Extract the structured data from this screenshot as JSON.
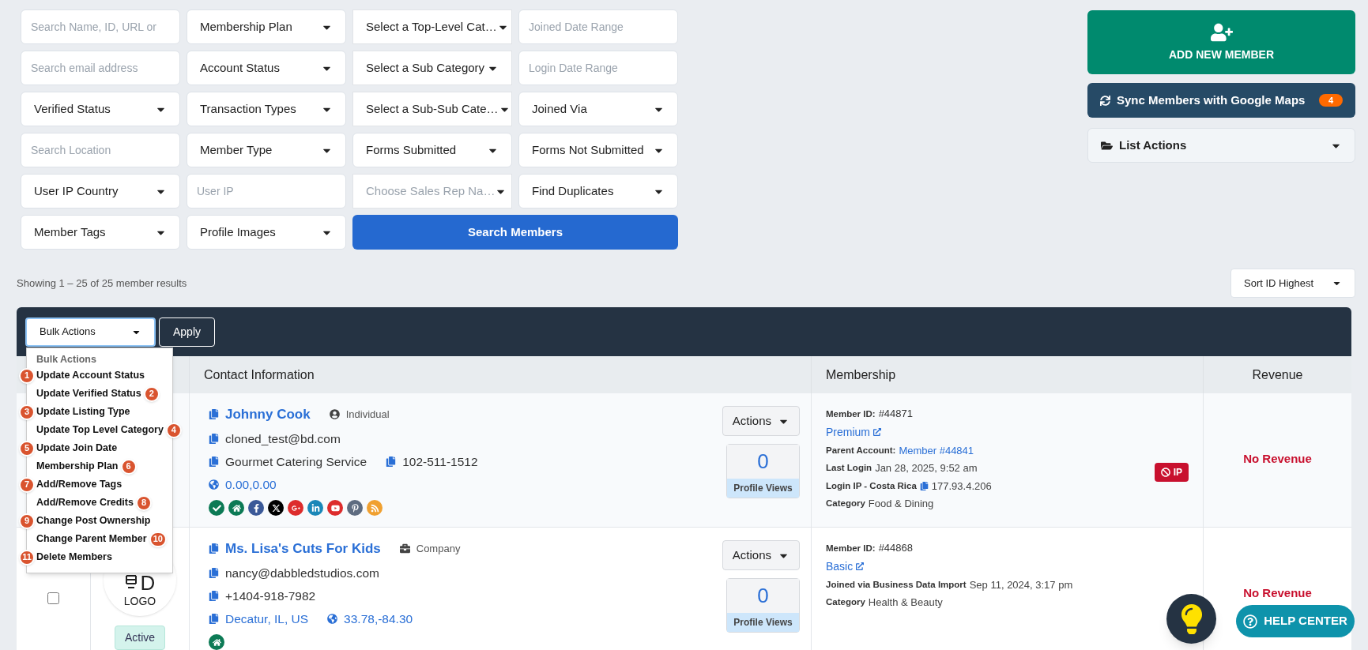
{
  "filters": [
    {
      "kind": "input",
      "placeholder": "Search Name, ID, URL or"
    },
    {
      "kind": "select",
      "value": "Membership Plan"
    },
    {
      "kind": "category-select",
      "value": "Select a Top-Level Cat…"
    },
    {
      "kind": "input",
      "placeholder": "Joined Date Range"
    },
    {
      "kind": "input",
      "placeholder": "Search email address"
    },
    {
      "kind": "select",
      "value": "Account Status"
    },
    {
      "kind": "category-select",
      "value": "Select a Sub Category"
    },
    {
      "kind": "input",
      "placeholder": "Login Date Range"
    },
    {
      "kind": "select",
      "value": "Verified Status"
    },
    {
      "kind": "select",
      "value": "Transaction Types"
    },
    {
      "kind": "category-select",
      "value": "Select a Sub-Sub Cate…"
    },
    {
      "kind": "select",
      "value": "Joined Via"
    },
    {
      "kind": "input",
      "placeholder": "Search Location"
    },
    {
      "kind": "select",
      "value": "Member Type"
    },
    {
      "kind": "select",
      "value": "Forms Submitted"
    },
    {
      "kind": "select",
      "value": "Forms Not Submitted"
    },
    {
      "kind": "select",
      "value": "User IP Country"
    },
    {
      "kind": "input",
      "placeholder": "User IP"
    },
    {
      "kind": "category-select",
      "value": "Choose Sales Rep Na…",
      "muted": true
    },
    {
      "kind": "select",
      "value": "Find Duplicates"
    },
    {
      "kind": "select",
      "value": "Member Tags"
    },
    {
      "kind": "select",
      "value": "Profile Images"
    },
    {
      "kind": "submit",
      "value": "Search Members"
    }
  ],
  "add_member": {
    "label": "ADD NEW MEMBER"
  },
  "sync": {
    "label": "Sync Members with Google Maps",
    "count": "4"
  },
  "list_actions": {
    "label": "List Actions"
  },
  "results_text": "Showing 1 – 25 of 25 member results",
  "sort": {
    "value": "Sort ID Highest"
  },
  "bulk": {
    "value": "Bulk Actions",
    "apply": "Apply",
    "menu_header": "Bulk Actions",
    "menu": [
      {
        "badge": "1",
        "label": "Update Account Status",
        "kind": "badge-left"
      },
      {
        "badge": "2",
        "label": "Update Verified Status",
        "kind": "badge-right"
      },
      {
        "badge": "3",
        "label": "Update Listing Type",
        "kind": "badge-left"
      },
      {
        "badge": "4",
        "label": "Update Top Level Category",
        "kind": "badge-right"
      },
      {
        "badge": "5",
        "label": "Update Join Date",
        "kind": "badge-left"
      },
      {
        "badge": "6",
        "label": "Membership Plan",
        "kind": "badge-right"
      },
      {
        "badge": "7",
        "label": "Add/Remove Tags",
        "kind": "badge-left"
      },
      {
        "badge": "8",
        "label": "Add/Remove Credits",
        "kind": "badge-right"
      },
      {
        "badge": "9",
        "label": "Change Post Ownership",
        "kind": "badge-left"
      },
      {
        "badge": "10",
        "label": "Change Parent Member",
        "kind": "badge-right"
      },
      {
        "badge": "11",
        "label": "Delete Members",
        "kind": "badge-left"
      }
    ]
  },
  "table": {
    "columns": [
      "Contact Information",
      "Membership",
      "Revenue"
    ],
    "rows": [
      {
        "name": "Johnny Cook",
        "type": {
          "kind": "person",
          "label": "Individual"
        },
        "lines": [
          [
            {
              "kind": "copy",
              "text": "cloned_test@bd.com"
            }
          ],
          [
            {
              "kind": "copy",
              "text": "Gourmet Catering Service"
            },
            {
              "kind": "copy",
              "text": "102-511-1512"
            }
          ],
          [
            {
              "kind": "globe",
              "text": "0.00,0.00",
              "link": true
            }
          ]
        ],
        "social": [
          {
            "kind": "check"
          },
          {
            "kind": "home"
          },
          {
            "kind": "facebook"
          },
          {
            "kind": "x"
          },
          {
            "kind": "google-plus"
          },
          {
            "kind": "linkedin"
          },
          {
            "kind": "youtube"
          },
          {
            "kind": "pinterest"
          },
          {
            "kind": "rss"
          }
        ],
        "actions": "Actions",
        "views": "0",
        "views_label": "Profile Views",
        "member_id_label": "Member ID:",
        "member_id": "#44871",
        "plan": "Premium",
        "details": [
          {
            "kind": "link",
            "label": "Parent Account:",
            "value": "Member #44841"
          },
          {
            "kind": "text",
            "label": "Last Login",
            "value": "Jan 28, 2025, 9:52 am"
          },
          {
            "kind": "copy",
            "label": "Login IP - Costa Rica",
            "value": "177.93.4.206"
          },
          {
            "kind": "text",
            "label": "Category",
            "value": "Food & Dining"
          }
        ],
        "ip_badge": "IP",
        "revenue": "No Revenue"
      },
      {
        "checked": false,
        "logo_mark": "D",
        "logo_text": "LOGO",
        "status": "Active",
        "name": "Ms. Lisa's Cuts For Kids",
        "type": {
          "kind": "company",
          "label": "Company"
        },
        "lines": [
          [
            {
              "kind": "copy",
              "text": "nancy@dabbledstudios.com"
            }
          ],
          [
            {
              "kind": "copy",
              "text": "+1404-918-7982"
            }
          ],
          [
            {
              "kind": "copy",
              "text": "Decatur, IL, US",
              "link": true
            },
            {
              "kind": "globe",
              "text": "33.78,-84.30",
              "link": true
            }
          ]
        ],
        "social": [
          {
            "kind": "home"
          }
        ],
        "actions": "Actions",
        "views": "0",
        "views_label": "Profile Views",
        "member_id_label": "Member ID:",
        "member_id": "#44868",
        "plan": "Basic",
        "details": [
          {
            "kind": "text",
            "label": "Joined via Business Data Import",
            "value": "Sep 11, 2024, 3:17 pm"
          },
          {
            "kind": "text",
            "label": "Category",
            "value": "Health & Beauty"
          }
        ],
        "revenue": "No Revenue"
      }
    ]
  },
  "help": {
    "label": "HELP CENTER"
  }
}
